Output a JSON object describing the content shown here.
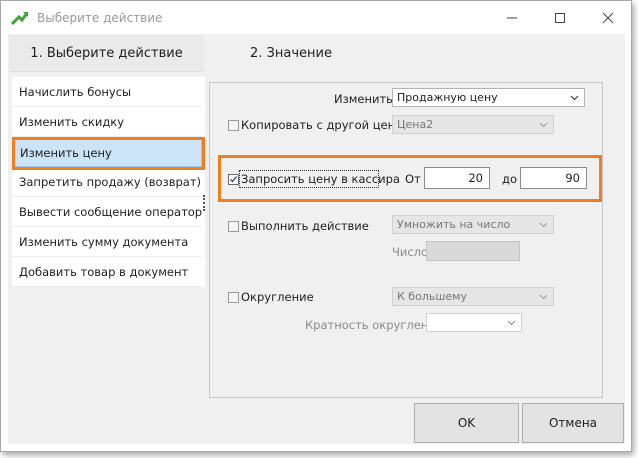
{
  "window": {
    "title": "Выберите действие"
  },
  "steps": {
    "left": "1. Выберите  действие",
    "right": "2. Значение"
  },
  "actions": [
    {
      "label": "Начислить бонусы",
      "selected": false
    },
    {
      "label": "Изменить скидку",
      "selected": false
    },
    {
      "label": "Изменить цену",
      "selected": true
    },
    {
      "label": "Запретить продажу (возврат)",
      "selected": false
    },
    {
      "label": "Вывести сообщение оператору",
      "selected": false
    },
    {
      "label": "Изменить сумму документа",
      "selected": false
    },
    {
      "label": "Добавить товар в документ",
      "selected": false
    }
  ],
  "form": {
    "change_label": "Изменить",
    "change_value": "Продажную цену",
    "copy_label": "Копировать с другой цены",
    "copy_checked": false,
    "copy_value": "Цена2",
    "ask_label": "Запросить цену в кассира",
    "ask_checked": true,
    "from_label": "От",
    "from_value": "20",
    "to_label": "до",
    "to_value": "90",
    "do_action_label": "Выполнить действие",
    "do_action_checked": false,
    "do_action_value": "Умножить на число",
    "number_label": "Число",
    "number_value": "",
    "round_label": "Округление",
    "round_checked": false,
    "round_value": "К большему",
    "round_mult_label": "Кратность округления",
    "round_mult_value": ""
  },
  "buttons": {
    "ok": "OK",
    "cancel": "Отмена"
  },
  "colors": {
    "highlight": "#f07d1e",
    "selection": "#cce4f7"
  }
}
